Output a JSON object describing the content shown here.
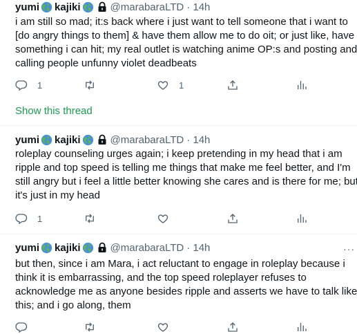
{
  "tweets": [
    {
      "display_name": "yumi",
      "display_name2": "kajiki",
      "handle": "@marabaraLTD",
      "time": "· 14h",
      "lines": [
        "i am still so mad; it:s back where i just want to tell someone that i want to",
        "[do angry things to them] & have them allow me to do oit; or just like, have",
        "something i can hit; my real outlet is watching anime OP:s and posting and",
        "calling people unfunny violet deadbeats"
      ],
      "reply_count": "1",
      "retweet_count": "",
      "like_count": "1"
    },
    {
      "display_name": "yumi",
      "display_name2": "kajiki",
      "handle": "@marabaraLTD",
      "time": "· 14h",
      "lines": [
        "roleplay counseling urges again; i keep pretending in my head that i am",
        "ripple and top speed is telling me things that make me feel better, and I'm",
        "still angry but i feel a little better knowing she cares and is there for me; but",
        "it's just in my head"
      ],
      "reply_count": "1",
      "retweet_count": "",
      "like_count": ""
    },
    {
      "display_name": "yumi",
      "display_name2": "kajiki",
      "handle": "@marabaraLTD",
      "time": "· 14h",
      "lines": [
        "but then, since i am Mara, i act reluctant to engage in roleplay because i",
        "think it is embarrassing, and the top speed roleplayer refuses to",
        "acknowledge me as anyone besides ripple and asserts we have to talk like",
        "this; and i go along, them"
      ],
      "reply_count": "",
      "retweet_count": "",
      "like_count": ""
    }
  ],
  "show_thread_label": "Show this thread",
  "more_label": "···",
  "icons": [
    "globe-emoji-icon",
    "lock-icon",
    "reply-icon",
    "retweet-icon",
    "like-icon",
    "share-icon",
    "analytics-icon"
  ],
  "colors": {
    "text": "#0f1419",
    "muted": "#536471",
    "show_thread": "#1d9b50"
  }
}
